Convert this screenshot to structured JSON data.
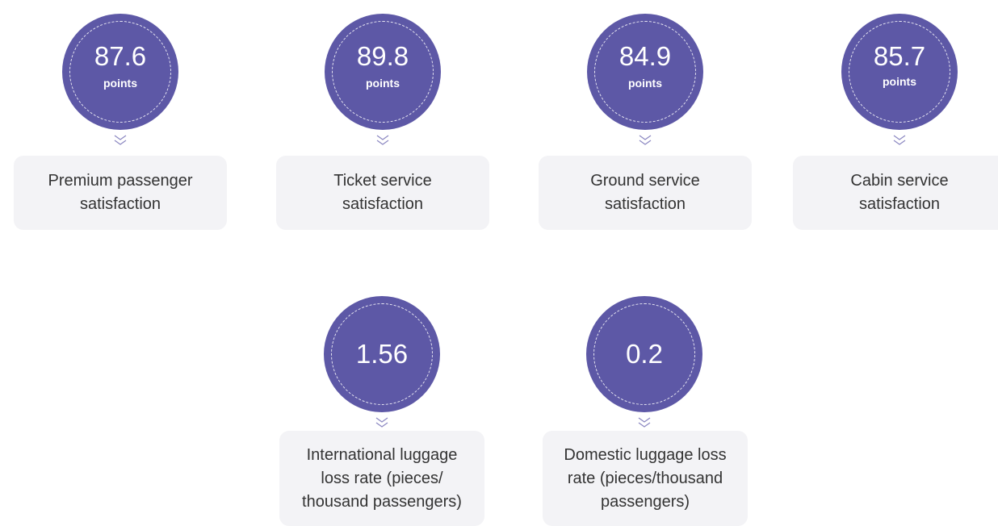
{
  "metrics": [
    {
      "value": "87.6",
      "unit": "points",
      "label": [
        "Premium passenger",
        "satisfaction"
      ]
    },
    {
      "value": "89.8",
      "unit": "points",
      "label": [
        "Ticket service",
        "satisfaction"
      ]
    },
    {
      "value": "84.9",
      "unit": "points",
      "label": [
        "Ground service",
        "satisfaction"
      ]
    },
    {
      "value": "85.7",
      "unit": "points",
      "label": [
        "Cabin service",
        "satisfaction"
      ]
    },
    {
      "value": "1.56",
      "unit": "",
      "label": [
        "International luggage",
        "loss rate (pieces/",
        "thousand passengers)"
      ]
    },
    {
      "value": "0.2",
      "unit": "",
      "label": [
        "Domestic luggage loss",
        "rate (pieces/thousand",
        "passengers)"
      ]
    }
  ],
  "colors": {
    "circle": "#5d58a6",
    "card_bg": "#f3f3f6",
    "text": "#333333",
    "chevron": "#8d89c2"
  }
}
